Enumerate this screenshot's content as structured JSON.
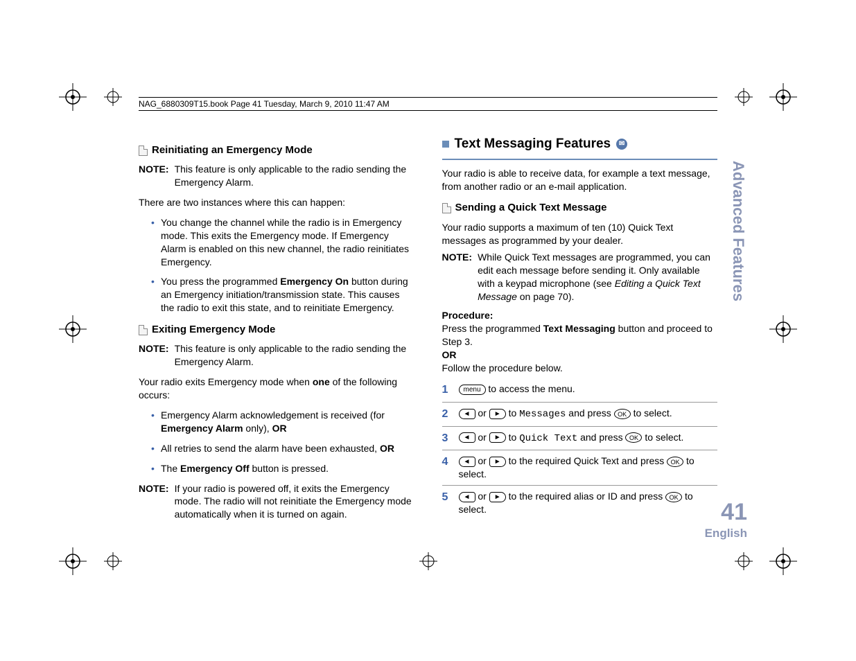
{
  "header": "NAG_6880309T15.book  Page 41  Tuesday, March 9, 2010  11:47 AM",
  "left": {
    "h1": "Reinitiating an Emergency Mode",
    "note1_label": "NOTE:",
    "note1": "This feature is only applicable to the radio sending the Emergency Alarm.",
    "p1": "There are two instances where this can happen:",
    "b1": "You change the channel while the radio is in Emergency mode. This exits the Emergency mode. If Emergency Alarm is enabled on this new channel, the radio reinitiates Emergency.",
    "b2a": "You press the programmed ",
    "b2b": "Emergency On",
    "b2c": " button during an Emergency initiation/transmission state. This causes the radio to exit this state, and to reinitiate Emergency.",
    "h2": "Exiting Emergency Mode",
    "note2_label": "NOTE:",
    "note2": "This feature is only applicable to the radio sending the Emergency Alarm.",
    "p2a": "Your radio exits Emergency mode when ",
    "p2b": "one",
    "p2c": " of the following occurs:",
    "b3a": "Emergency Alarm acknowledgement is received (for ",
    "b3b": "Emergency Alarm",
    "b3c": " only), ",
    "b3d": "OR",
    "b4a": "All retries to send the alarm have been exhausted, ",
    "b4b": "OR",
    "b5a": "The ",
    "b5b": "Emergency Off",
    "b5c": " button is pressed.",
    "note3_label": "NOTE:",
    "note3": "If your radio is powered off, it exits the Emergency mode. The radio will not reinitiate the Emergency mode automatically when it is turned on again."
  },
  "right": {
    "section": "Text Messaging Features",
    "intro": "Your radio is able to receive data, for example a text message, from another radio or an e-mail application.",
    "h1": "Sending a Quick Text Message",
    "p1": "Your radio supports a maximum of ten (10) Quick Text messages as programmed by your dealer.",
    "note_label": "NOTE:",
    "note_a": "While Quick Text messages are programmed, you can edit each message before sending it. Only available with a keypad microphone (see ",
    "note_b": "Editing a Quick Text Message",
    "note_c": " on page 70).",
    "proc_label": "Procedure:",
    "proc_a": "Press the programmed ",
    "proc_b": "Text Messaging",
    "proc_c": " button and proceed to Step 3.",
    "or": "OR",
    "proc_follow": "Follow the procedure below.",
    "s1": " to access the menu.",
    "s_or": "or",
    "s_to": " to ",
    "s_and": " and press ",
    "s_sel": " to select.",
    "s2_target": "Messages",
    "s3_target": "Quick Text",
    "s4": " to the required Quick Text and press ",
    "s5": " to the required alias or ID and press ",
    "menu_key": "menu",
    "ok_key": "OK"
  },
  "side": {
    "tab": "Advanced Features",
    "page": "41",
    "lang": "English"
  }
}
